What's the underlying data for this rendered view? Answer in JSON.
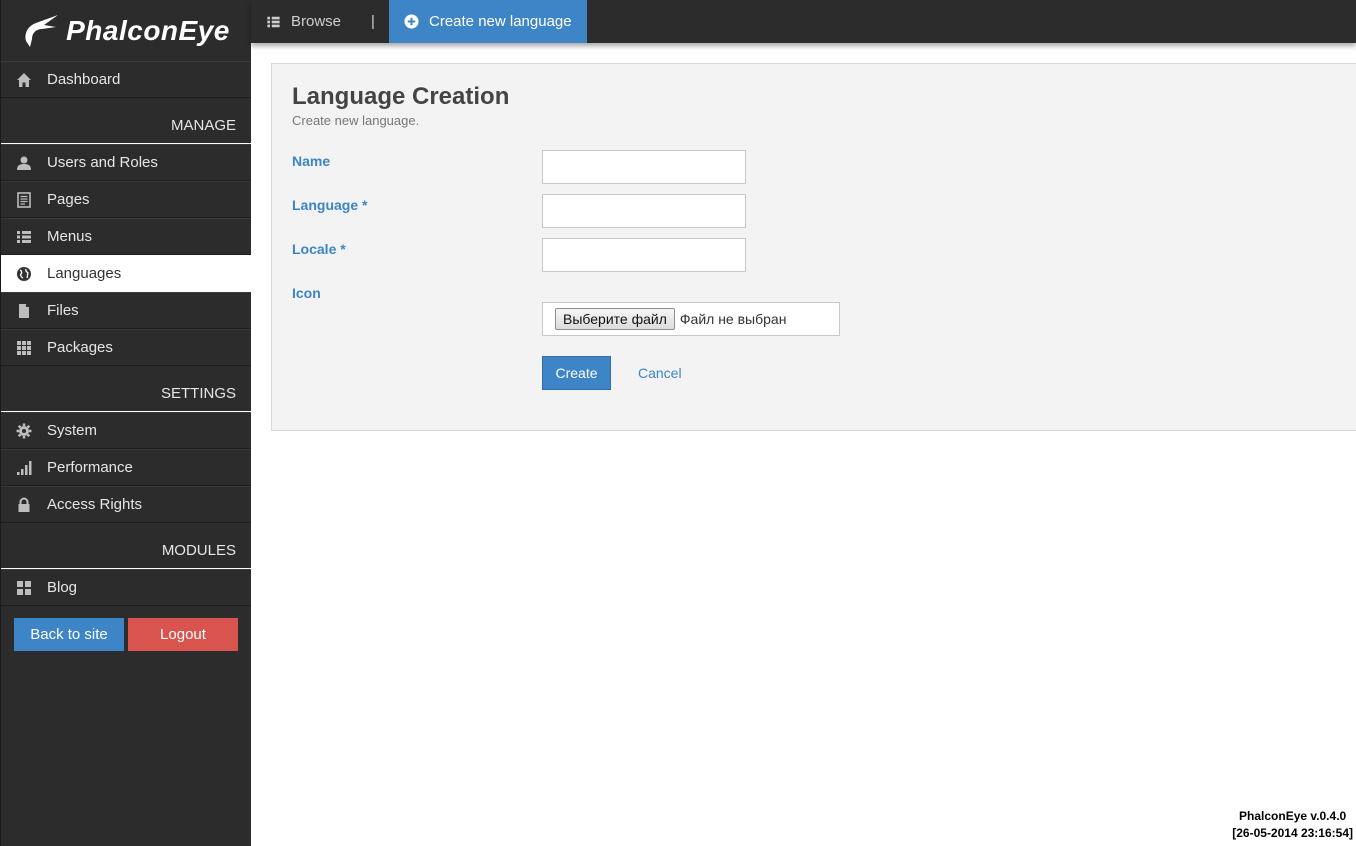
{
  "app": {
    "logo_text": "PhalconEye"
  },
  "topbar": {
    "tabs": [
      {
        "label": "Browse",
        "icon": "list-icon"
      },
      {
        "label": "|"
      },
      {
        "label": "Create new language",
        "icon": "plus-circle-icon",
        "active": true
      }
    ]
  },
  "sidebar": {
    "dashboard": "Dashboard",
    "sections": {
      "manage": "MANAGE",
      "settings": "SETTINGS",
      "modules": "MODULES"
    },
    "manage_items": [
      {
        "label": "Users and Roles",
        "icon": "user-icon"
      },
      {
        "label": "Pages",
        "icon": "pages-icon"
      },
      {
        "label": "Menus",
        "icon": "list-icon"
      },
      {
        "label": "Languages",
        "icon": "globe-icon",
        "active": true
      },
      {
        "label": "Files",
        "icon": "file-icon"
      },
      {
        "label": "Packages",
        "icon": "grid-icon"
      }
    ],
    "settings_items": [
      {
        "label": "System",
        "icon": "gear-icon"
      },
      {
        "label": "Performance",
        "icon": "bar-chart-icon"
      },
      {
        "label": "Access Rights",
        "icon": "lock-icon"
      }
    ],
    "modules_items": [
      {
        "label": "Blog",
        "icon": "tiles-icon"
      }
    ],
    "back_to_site": "Back to site",
    "logout": "Logout"
  },
  "form": {
    "title": "Language Creation",
    "subtitle": "Create new language.",
    "fields": {
      "name_label": "Name",
      "name_value": "",
      "language_label": "Language *",
      "language_value": "",
      "locale_label": "Locale *",
      "locale_value": "",
      "icon_label": "Icon",
      "file_button": "Выберите файл",
      "file_status": "Файл не выбран"
    },
    "create_button": "Create",
    "cancel_link": "Cancel"
  },
  "footer": {
    "version": "PhalconEye v.0.4.0",
    "timestamp": "[26-05-2014 23:16:54]"
  },
  "colors": {
    "accent": "#3d85c6",
    "danger": "#d9534f",
    "sidebar_bg": "#2c2c2c"
  }
}
